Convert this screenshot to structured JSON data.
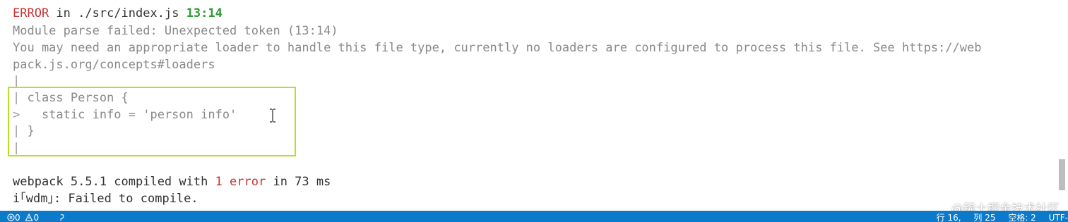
{
  "terminal": {
    "error_word": "ERROR",
    "error_in": " in ",
    "error_path": "./src/index.js",
    "error_pos": "13:14",
    "parse_failed": "Module parse failed: Unexpected token (13:14)",
    "loader_msg_1": "You may need an appropriate loader to handle this file type, currently no loaders are configured to process this file. See https://web",
    "loader_msg_2": "pack.js.org/concepts#loaders",
    "code_pipe_1": "|",
    "code_line_1_marker": "| ",
    "code_line_1": "class Person {",
    "code_line_2_marker": ">   ",
    "code_line_2": "static info = 'person info'",
    "code_line_3_marker": "| ",
    "code_line_3": "}",
    "code_pipe_2": "|",
    "compiled_prefix": "webpack 5.5.1 compiled with ",
    "compiled_error": "1 error",
    "compiled_suffix": " in 73 ms",
    "wdm_line": "i｢wdm｣: Failed to compile."
  },
  "statusbar": {
    "errors_icon": "error-circle-icon",
    "errors_count": "0",
    "warnings_icon": "warning-triangle-icon",
    "warnings_count": "0",
    "extra_icon": "sync-icon",
    "line": "行 16",
    "col": "列 25",
    "spaces": "空格: 2",
    "encoding": "UTF-"
  },
  "watermark": "@稀土掘金技术社区",
  "colors": {
    "error_red": "#c43535",
    "position_green": "#2e9a35",
    "highlight_box": "#b5e02a",
    "statusbar_blue": "#0c7acb"
  }
}
